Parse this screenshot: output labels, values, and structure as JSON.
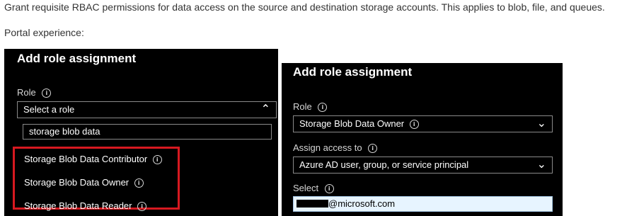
{
  "intro": {
    "text": "Grant requisite RBAC permissions for data access on the source and destination storage accounts. This applies to blob, file, and queues.",
    "portal_label": "Portal experience:"
  },
  "left_panel": {
    "title": "Add role assignment",
    "role_label": "Role",
    "role_dropdown_value": "Select a role",
    "search_value": "storage blob data",
    "options": [
      "Storage Blob Data Contributor",
      "Storage Blob Data Owner",
      "Storage Blob Data Reader"
    ]
  },
  "right_panel": {
    "title": "Add role assignment",
    "role_label": "Role",
    "role_value": "Storage Blob Data Owner",
    "assign_label": "Assign access to",
    "assign_value": "Azure AD user, group, or service principal",
    "select_label": "Select",
    "select_suffix": "@microsoft.com"
  },
  "icons": {
    "info": "info-icon",
    "chevron_up": "chevron-up-icon",
    "chevron_down": "chevron-down-icon"
  },
  "colors": {
    "panel_background": "#000000",
    "highlight_border": "#d71920",
    "selected_input_background": "#e7f4ff"
  }
}
